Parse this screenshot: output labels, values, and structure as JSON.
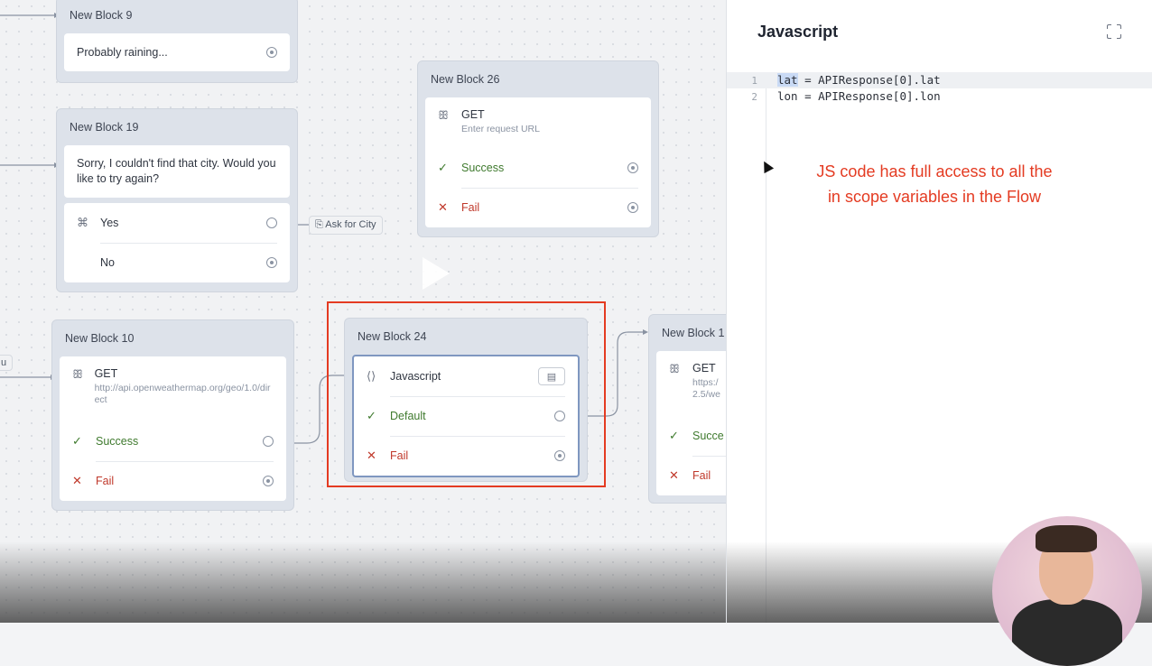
{
  "blocks": {
    "b9": {
      "title": "New Block 9",
      "message": "Probably raining..."
    },
    "b19": {
      "title": "New Block 19",
      "message": "Sorry, I couldn't find that city. Would you like to try again?",
      "options": [
        "Yes",
        "No"
      ],
      "link_tag": "Ask for City"
    },
    "b26": {
      "title": "New Block 26",
      "method": "GET",
      "url_placeholder": "Enter request URL",
      "success": "Success",
      "fail": "Fail"
    },
    "b10": {
      "title": "New Block 10",
      "method": "GET",
      "url": "http://api.openweathermap.org/geo/1.0/direct",
      "success": "Success",
      "fail": "Fail",
      "left_tag": "u"
    },
    "b24": {
      "title": "New Block 24",
      "step": "Javascript",
      "default": "Default",
      "fail": "Fail"
    },
    "b1x": {
      "title": "New Block 1",
      "method": "GET",
      "url": "https:/ 2.5/we",
      "success": "Succe",
      "fail": "Fail"
    }
  },
  "panel": {
    "title": "Javascript",
    "code": [
      {
        "num": "1",
        "sel": "lat",
        "rest": " = APIResponse[0].lat"
      },
      {
        "num": "2",
        "sel": "",
        "rest": "lon = APIResponse[0].lon"
      }
    ],
    "note_line1": "JS code has full access to all the",
    "note_line2": "in scope variables in the Flow"
  },
  "colors": {
    "annotation": "#e43b22",
    "success": "#3f7a2e",
    "fail": "#c0392b"
  }
}
